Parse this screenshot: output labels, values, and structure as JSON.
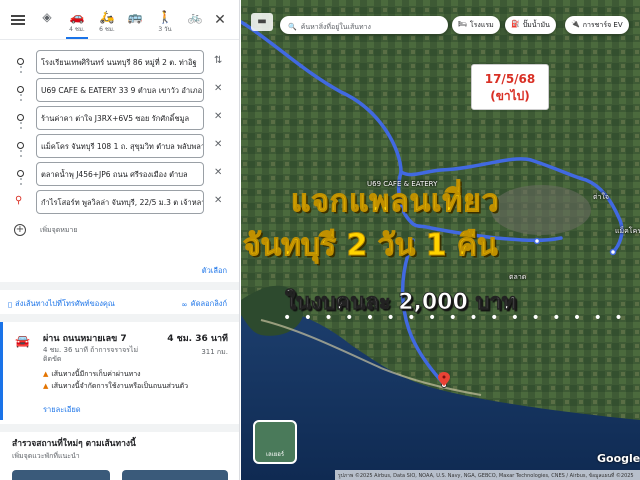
{
  "panel": {
    "modes": [
      {
        "icon": "diamond-directions-icon",
        "glyph": "◈",
        "label": ""
      },
      {
        "icon": "car-icon",
        "glyph": "🚗",
        "label": "4 ชม."
      },
      {
        "icon": "motorcycle-icon",
        "glyph": "🛵",
        "label": "6 ชม."
      },
      {
        "icon": "bus-icon",
        "glyph": "🚌",
        "label": ""
      },
      {
        "icon": "walk-icon",
        "glyph": "🚶",
        "label": "3 วัน"
      },
      {
        "icon": "bicycle-icon",
        "glyph": "🚲",
        "label": ""
      }
    ],
    "stops": [
      "โรงเรียนเทพศิรินทร์ นนทบุรี 86 หมู่ที่ 2 ต. ท่าอิฐ",
      "U69 CAFE & EATERY 33 9 ตำบล เขาวัว อำเภอ",
      "ร้านค่าคา ต่าใจ J3RX+6V5 ซอย รักศักดิ์ชมูล",
      "แม็คโคร จันทบุรี 108 1 ถ. สุขุมวิท ตำบล พลับพลา",
      "ตลาดน้ำพุ J456+JP6 ถนน ศรีรองเมือง ตำบล",
      "กำไรโสอร์ท พูลวิลล่า จันทบุรี, 22/5 ม.3 ต เจ้าหลาว"
    ],
    "add_stop": "เพิ่มจุดหมาย",
    "options": "ตัวเลือก",
    "send_to_phone": "ส่งเส้นทางไปที่โทรศัพท์ของคุณ",
    "copy_link": "คัดลอกลิงก์",
    "route": {
      "via": "ผ่าน ถนนหมายเลข 7",
      "duration": "4 ชม. 36 นาที",
      "subtitle": "4 ชม. 36 นาที ถ้าการจราจรไม่ติดขัด",
      "distance": "311 กม.",
      "warnings": [
        "เส้นทางนี้มีการเก็บค่าผ่านทาง",
        "เส้นทางนี้จำกัดการใช้งานหรือเป็นถนนส่วนตัว"
      ],
      "details": "รายละเอียด"
    },
    "explore_title": "สำรวจสถานที่ใหม่ๆ ตามเส้นทางนี้",
    "explore_sub": "เพิ่มจุดแวะพักที่แนะนำ"
  },
  "map": {
    "search_placeholder": "ค้นหาสิ่งที่อยู่ในเส้นทาง",
    "chips": [
      {
        "icon": "hotel-icon",
        "glyph": "🛏",
        "label": "โรงแรม"
      },
      {
        "icon": "gas-icon",
        "glyph": "⛽",
        "label": "ปั๊มน้ำมัน"
      },
      {
        "icon": "ev-icon",
        "glyph": "🔌",
        "label": "การชาร์จ EV"
      }
    ],
    "date_line1": "17/5/68",
    "date_line2": "(ขาไป)",
    "headline1": "แจกแพลนเที่ยว",
    "headline2": "จันทบุรี 2 วัน 1 คืน",
    "headline3": "ในงบคนละ 2,000 บาท",
    "dots": "• • • • • • • • • • • • • • • • •",
    "place_labels": [
      "U69 CAFE & EATERY",
      "ต่าใจ",
      "แม็คโคร",
      "ตลาด"
    ],
    "layer_label": "เลเยอร์",
    "google": "Google",
    "attribution": "รูปภาพ ©2025 Airbus, Data SIO, NOAA, U.S. Navy, NGA, GEBCO, Maxar Technologies, CNES / Airbus, ข้อมูลแผนที่ ©2025"
  },
  "colors": {
    "accent": "#1a73e8",
    "route": "#4169e1",
    "title_yellow": "#ffd400",
    "date_red": "#d93025"
  }
}
